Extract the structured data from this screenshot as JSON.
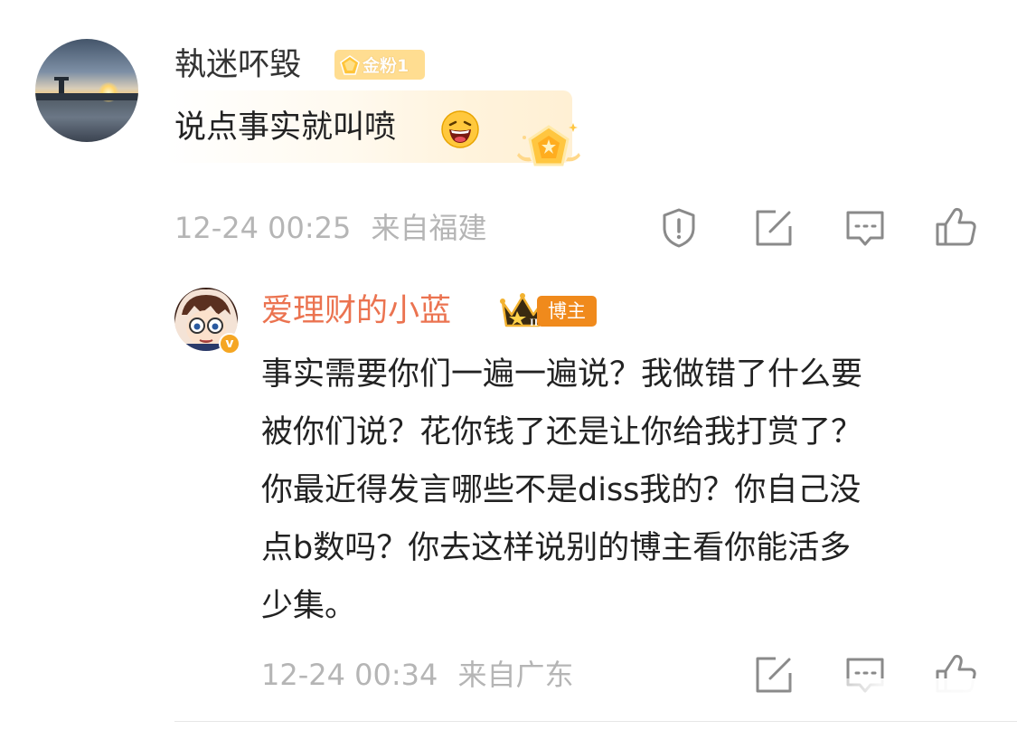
{
  "comment": {
    "username": "執迷吥毀",
    "fan_badge": "金粉1",
    "text": "说点事实就叫喷",
    "emoji_icon": "laughing-face-emoji",
    "timestamp": "12-24 00:25",
    "location": "来自福建",
    "actions": [
      "report-icon",
      "repost-icon",
      "reply-icon",
      "like-icon"
    ]
  },
  "reply": {
    "username": "爱理财的小蓝",
    "role_badge": "博主",
    "lines": [
      "事实需要你们一遍一遍说？我做错了什么要",
      "被你们说？花你钱了还是让你给我打赏了？",
      "你最近得发言哪些不是diss我的？你自己没",
      "点b数吗？你去这样说别的博主看你能活多",
      "少集。"
    ],
    "timestamp": "12-24 00:34",
    "location": "来自广东",
    "actions": [
      "repost-icon",
      "reply-icon",
      "like-icon"
    ]
  },
  "colors": {
    "username_blogger": "#eb7350",
    "meta_gray": "#b5b5b5",
    "fan_badge_bg": "#ffdd91",
    "blogger_badge_bg": "#f08a1c"
  }
}
